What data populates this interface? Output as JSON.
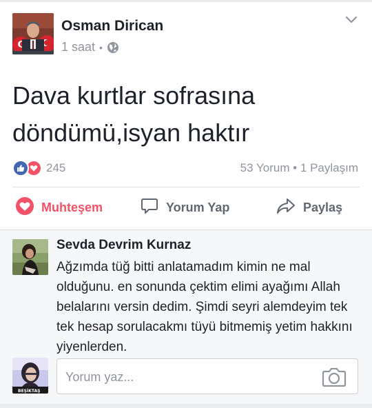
{
  "post": {
    "author": "Osman Dirican",
    "time": "1 saat",
    "meta_separator": "•",
    "privacy_icon": "globe-icon",
    "options_icon": "chevron-down-icon",
    "text": "Dava kurtlar sofrasına döndümü,isyan haktır",
    "reactions": {
      "types": [
        "like",
        "love"
      ],
      "count": "245"
    },
    "counts": {
      "comments": "53 Yorum",
      "separator": "•",
      "shares": "1 Paylaşım"
    },
    "actions": {
      "love_label": "Muhteşem",
      "comment_label": "Yorum Yap",
      "share_label": "Paylaş"
    }
  },
  "comment": {
    "author": "Sevda Devrim Kurnaz",
    "text": "Ağzımda tüğ bitti anlatamadım kimin ne mal olduğunu. en sonunda çektim elimi ayağımı Allah belalarını versin dedim. Şimdi seyri alemdeyim tek tek hesap sorulacakmı tüyü bitmemiş yetim hakkını yiyenlerden."
  },
  "composer": {
    "placeholder": "Yorum yaz...",
    "value": "",
    "avatar_badge": "BEŞİKTAŞ",
    "camera_icon": "camera-icon"
  },
  "colors": {
    "like_blue": "#4267b2",
    "love_red": "#f25268",
    "meta_gray": "#90949c",
    "action_gray": "#606770",
    "comments_bg": "#f6f7f9"
  }
}
